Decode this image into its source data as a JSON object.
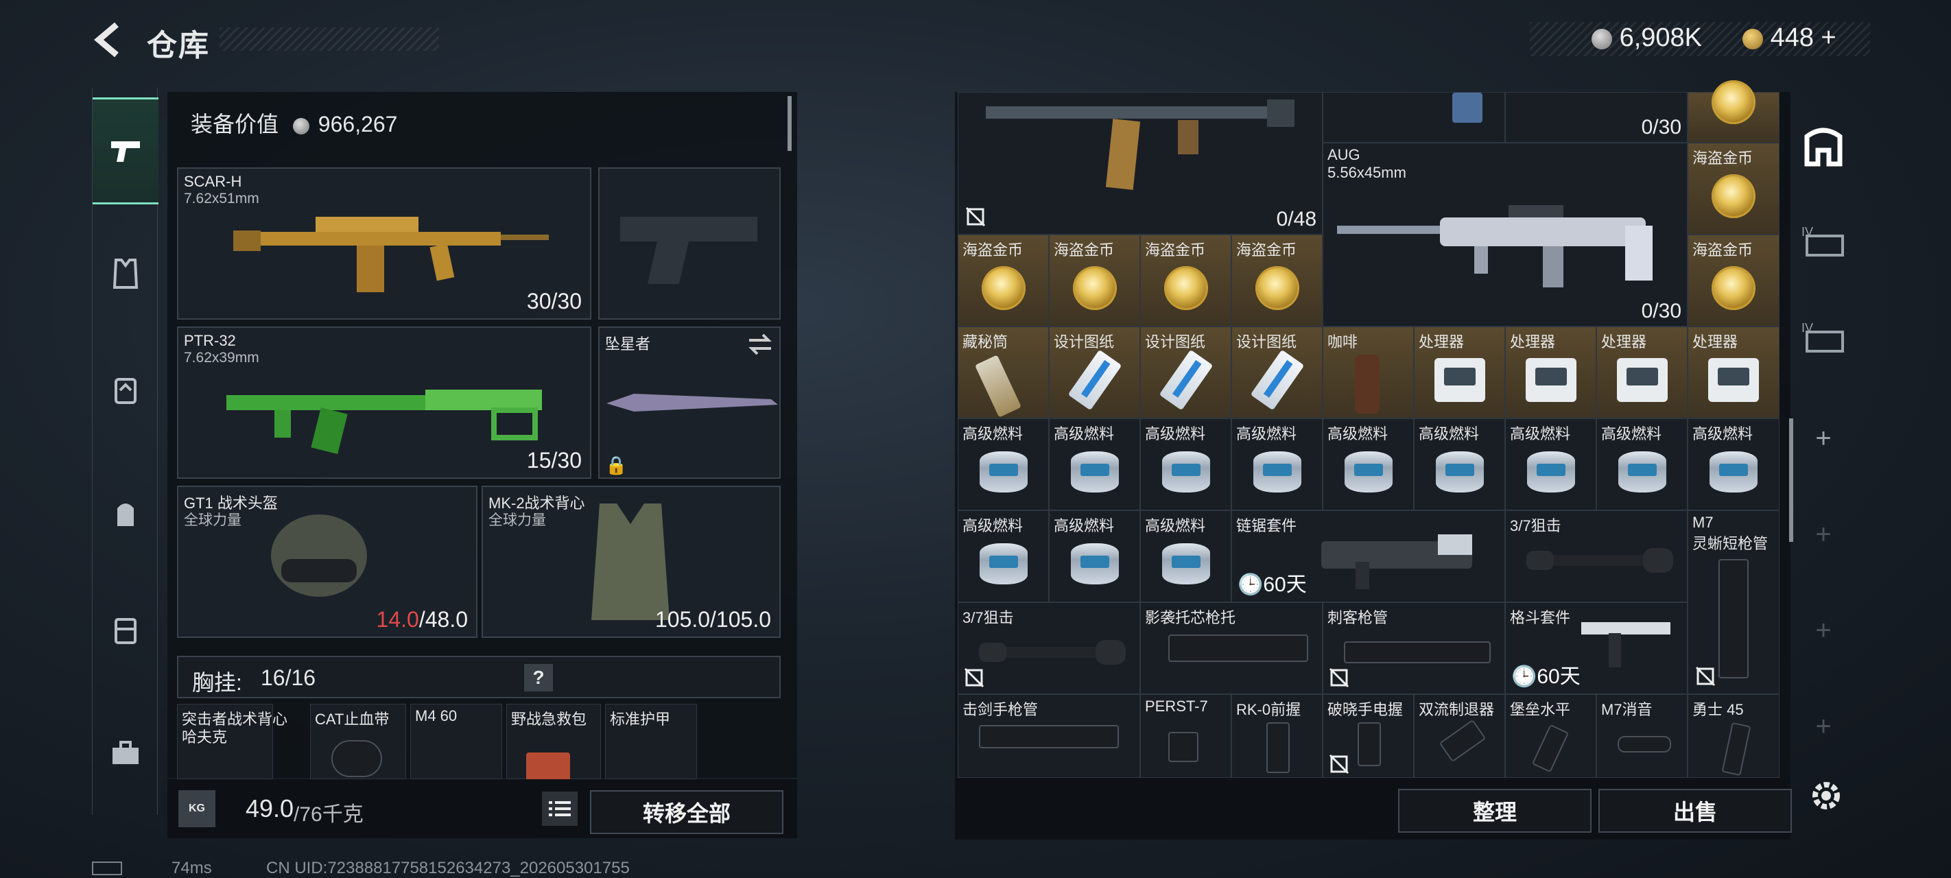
{
  "header": {
    "title": "仓库",
    "silver": "6,908K",
    "gold": "448",
    "plus": "+"
  },
  "equipment": {
    "value_label": "装备价值",
    "value": "966,267",
    "primary": {
      "name": "SCAR-H",
      "caliber": "7.62x51mm",
      "ammo": "30/30"
    },
    "secondary": {
      "name": "PTR-32",
      "caliber": "7.62x39mm",
      "ammo": "15/30"
    },
    "melee": {
      "name": "坠星者"
    },
    "helmet": {
      "name": "GT1 战术头盔",
      "brand": "全球力量",
      "durability_current": "14.0",
      "durability_max": "/48.0"
    },
    "vest": {
      "name": "MK-2战术背心",
      "brand": "全球力量",
      "durability": "105.0/105.0"
    },
    "chest_rig": {
      "label": "胸挂:",
      "count": "16/16",
      "help": "?"
    },
    "rig_items": [
      "突击者战术背心",
      "CAT止血带",
      "M4 60",
      "野战急救包",
      "标准护甲"
    ],
    "rig_item_sub": "哈夫克",
    "weight": "49.0",
    "weight_max": "/76千克",
    "weight_icon": "KG",
    "transfer_all": "转移全部"
  },
  "stash": {
    "row0": {
      "c1_count": "0/48",
      "c3_count": "0/30"
    },
    "aug": {
      "name": "AUG",
      "caliber": "5.56x45mm",
      "count": "0/30"
    },
    "coin_label": "海盗金币",
    "row2": [
      "藏秘筒",
      "设计图纸",
      "设计图纸",
      "设计图纸",
      "咖啡",
      "处理器",
      "处理器",
      "处理器",
      "处理器"
    ],
    "fuel_label": "高级燃料",
    "chainsaw": {
      "name": "链锯套件",
      "timer": "60天"
    },
    "scope37": "3/7狙击",
    "m7": {
      "name": "M7",
      "sub": "灵蜥短枪管"
    },
    "row5": [
      "3/7狙击",
      "影袭托芯枪托",
      "刺客枪管",
      "格斗套件"
    ],
    "grip_timer": "60天",
    "row6": [
      "击剑手枪管",
      "PERST-7",
      "RK-0前握",
      "破晓手电握",
      "双流制退器",
      "堡垒水平",
      "M7消音",
      "勇士 45"
    ],
    "sort": "整理",
    "sell": "出售"
  },
  "status": {
    "ping": "74ms",
    "uid": "CN UID:72388817758152634273_202605301755"
  }
}
